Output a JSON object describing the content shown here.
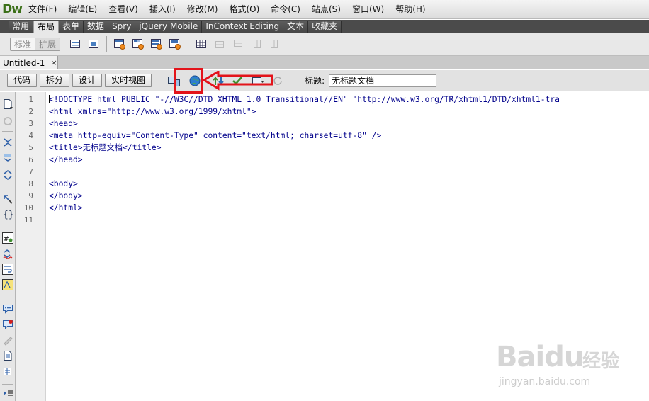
{
  "app": {
    "logo": "Dw"
  },
  "menubar": {
    "items": [
      "文件(F)",
      "编辑(E)",
      "查看(V)",
      "插入(I)",
      "修改(M)",
      "格式(O)",
      "命令(C)",
      "站点(S)",
      "窗口(W)",
      "帮助(H)"
    ]
  },
  "insert_panel": {
    "tabs": [
      "常用",
      "布局",
      "表单",
      "数据",
      "Spry",
      "jQuery Mobile",
      "InContext Editing",
      "文本",
      "收藏夹"
    ],
    "active_tab": "布局",
    "mode_buttons": [
      "标准",
      "扩展"
    ]
  },
  "document": {
    "tab_name": "Untitled-1",
    "close_glyph": "×"
  },
  "doc_toolbar": {
    "views": [
      "代码",
      "拆分",
      "设计",
      "实时视图"
    ],
    "title_label": "标题:",
    "title_value": "无标题文档"
  },
  "code": {
    "line_numbers": [
      "1",
      "2",
      "3",
      "4",
      "5",
      "6",
      "7",
      "8",
      "9",
      "10",
      "11"
    ],
    "lines": [
      "<!DOCTYPE html PUBLIC \"-//W3C//DTD XHTML 1.0 Transitional//EN\" \"http://www.w3.org/TR/xhtml1/DTD/xhtml1-tra",
      "<html xmlns=\"http://www.w3.org/1999/xhtml\">",
      "<head>",
      "<meta http-equiv=\"Content-Type\" content=\"text/html; charset=utf-8\" />",
      "<title>无标题文档</title>",
      "</head>",
      "",
      "<body>",
      "</body>",
      "</html>",
      ""
    ]
  },
  "watermark": {
    "brand": "Baidu",
    "brand_cn": "经验",
    "url": "jingyan.baidu.com"
  },
  "colors": {
    "annotation": "#e3141b",
    "code_tag": "#000099",
    "logo": "#3a6f17"
  }
}
